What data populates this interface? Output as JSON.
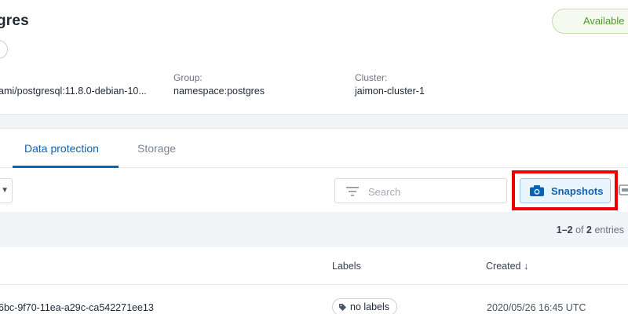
{
  "app": {
    "title": "gres",
    "status": "Available"
  },
  "details": {
    "image_value": "ami/postgresql:11.8.0-debian-10...",
    "group_label": "Group:",
    "group_value": "namespace:postgres",
    "cluster_label": "Cluster:",
    "cluster_value": "jaimon-cluster-1"
  },
  "tabs": [
    {
      "label": "Data protection",
      "active": true
    },
    {
      "label": "Storage",
      "active": false
    }
  ],
  "toolbar": {
    "search_placeholder": "Search",
    "snapshots_label": "Snapshots"
  },
  "pager": {
    "range": "1–2",
    "of": "of",
    "total": "2",
    "unit": "entries"
  },
  "table": {
    "columns": [
      "Labels",
      "Created ↓"
    ],
    "rows": [
      {
        "id": "6bc-9f70-11ea-a29c-ca542271ee13",
        "labels": "no labels",
        "created": "2020/05/26 16:45 UTC"
      }
    ]
  },
  "colors": {
    "accent": "#0a64b4",
    "status_ok": "#4f9a29",
    "highlight": "#ee0000"
  },
  "icons": [
    "filter-icon",
    "camera-icon",
    "tag-icon",
    "chevron-down-icon",
    "backup-icon"
  ]
}
